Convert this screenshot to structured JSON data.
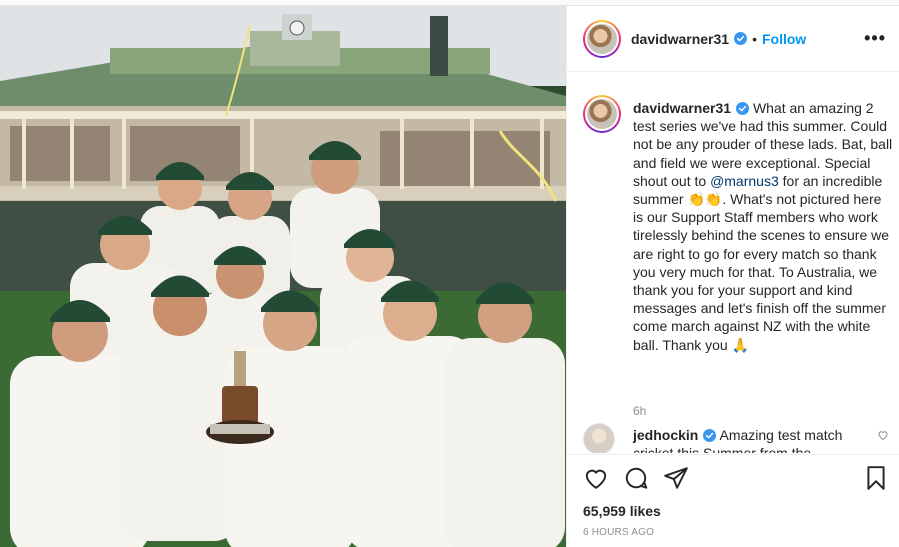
{
  "post": {
    "username": "davidwarner31",
    "follow_label": "Follow",
    "separator": "•",
    "more_label": "•••",
    "caption": {
      "username": "davidwarner31",
      "part1": " What an amazing 2 test series we've had this summer. Could not be any prouder of these lads. Bat, ball and field we were exceptional. Special shout out to ",
      "mention": "@marnus3",
      "part2": " for an incredible summer ",
      "emoji1": "👏👏",
      "part3": ". What's not pictured here is our Support Staff members who work tirelessly behind the scenes to ensure we are right to go for every match so thank you very much for that. To Australia, we thank you for your support and kind messages and let's finish off the summer come march against NZ with the white ball. Thank you ",
      "emoji2": "🙏"
    },
    "caption_time": "6h",
    "comment": {
      "username": "jedhockin",
      "text": " Amazing test match cricket this Summer from the"
    },
    "likes": "65,959 likes",
    "time_ago": "6 HOURS AGO"
  },
  "icons": {
    "more": "more-options-icon",
    "like": "heart-icon",
    "comment": "comment-icon",
    "share": "share-icon",
    "save": "bookmark-icon",
    "verified": "verified-badge-icon"
  },
  "colors": {
    "accent": "#0095f6",
    "text": "#262626",
    "muted": "#8e8e8e",
    "mention": "#00376b"
  }
}
